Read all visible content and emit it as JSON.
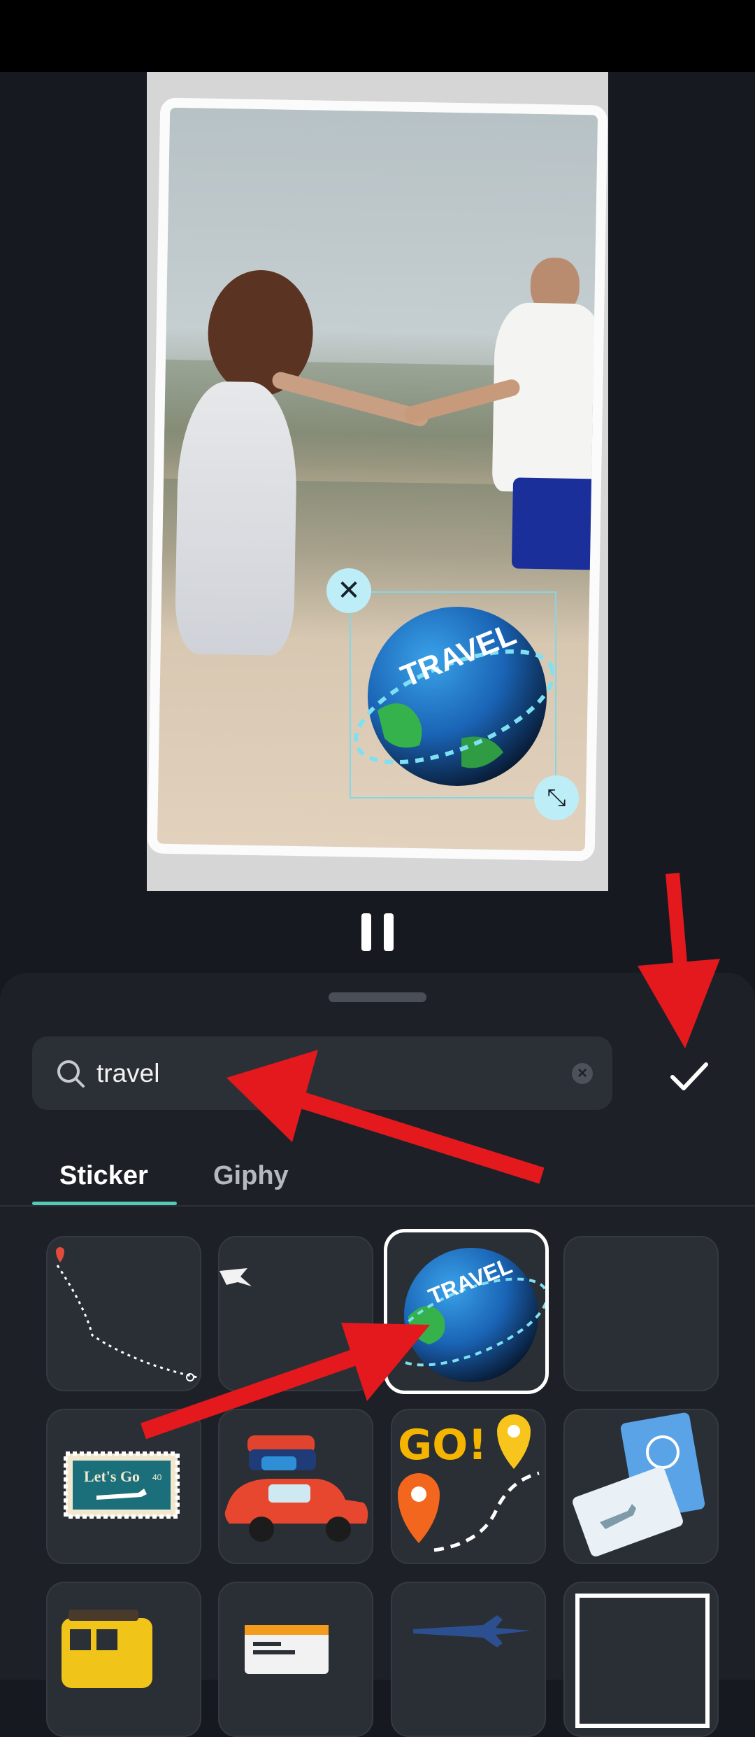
{
  "editor": {
    "sticker_overlay": {
      "text": "TRAVEL",
      "icon": "globe-sticker"
    },
    "playback": {
      "state_icon": "pause-icon"
    }
  },
  "sheet": {
    "search": {
      "value": "travel",
      "icon": "search-icon",
      "clear_icon": "clear-icon"
    },
    "done_icon": "checkmark-icon",
    "tabs": [
      {
        "label": "Sticker",
        "active": true
      },
      {
        "label": "Giphy",
        "active": false
      }
    ],
    "stickers": [
      {
        "name": "dotted-route-sticker"
      },
      {
        "name": "paper-plane-sticker"
      },
      {
        "name": "travel-globe-sticker",
        "text": "TRAVEL",
        "selected": true
      },
      {
        "name": "empty-sticker"
      },
      {
        "name": "lets-go-stamp-sticker",
        "text": "Let's Go",
        "number": "40"
      },
      {
        "name": "car-luggage-sticker"
      },
      {
        "name": "go-pins-sticker",
        "text": "GO!"
      },
      {
        "name": "passport-sticker"
      },
      {
        "name": "yellow-bus-sticker"
      },
      {
        "name": "ticket-sticker"
      },
      {
        "name": "airplane-sticker"
      },
      {
        "name": "frame-sticker"
      }
    ]
  },
  "colors": {
    "accent": "#53cbb8",
    "annotation_arrow": "#e3191d",
    "sheet_bg": "#1d2127"
  }
}
